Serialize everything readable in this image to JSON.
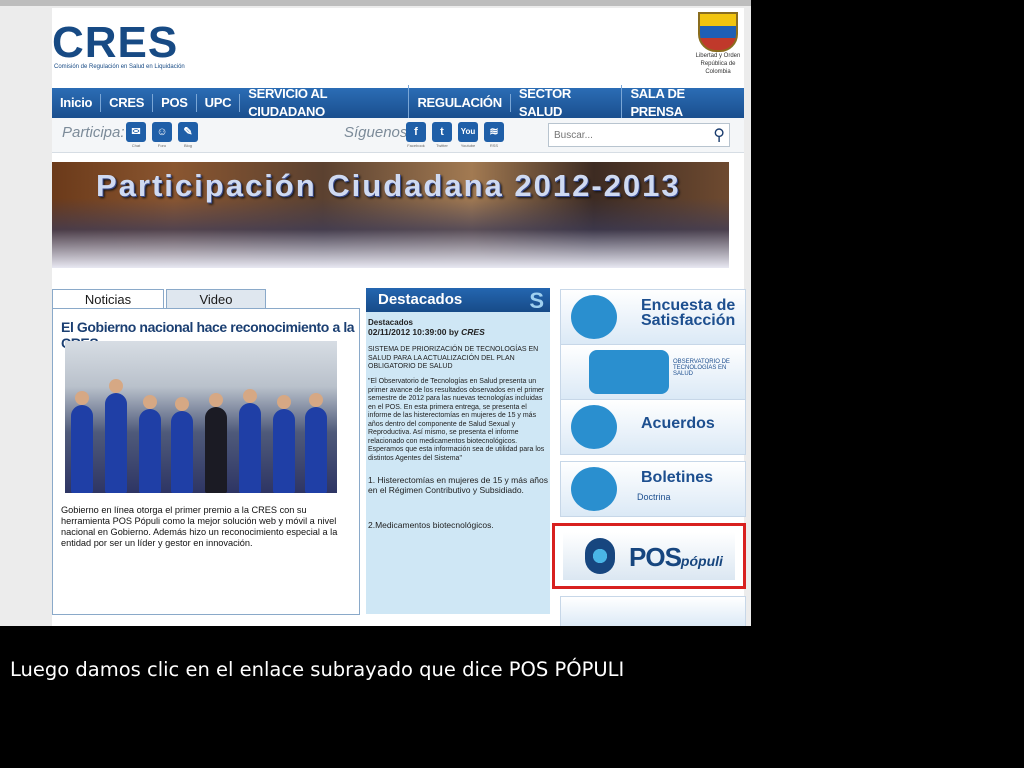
{
  "header": {
    "logo_text": "CRES",
    "logo_subtitle": "Comisión de Regulación en Salud en Liquidación",
    "seal_text_1": "Libertad y Orden",
    "seal_text_2": "República de Colombia"
  },
  "nav": {
    "items": [
      {
        "label": "Inicio"
      },
      {
        "label": "CRES"
      },
      {
        "label": "POS"
      },
      {
        "label": "UPC"
      },
      {
        "label": "SERVICIO AL CIUDADANO"
      },
      {
        "label": "REGULACIÓN"
      },
      {
        "label": "SECTOR SALUD"
      },
      {
        "label": "SALA DE PRENSA"
      }
    ]
  },
  "toolbar": {
    "participa_label": "Participa:",
    "participa_items": [
      {
        "caption": "Chat",
        "icon": "chat-icon"
      },
      {
        "caption": "Foro",
        "icon": "forum-icon"
      },
      {
        "caption": "Blog",
        "icon": "blog-icon"
      }
    ],
    "siguenos_label": "Síguenos:",
    "social_items": [
      {
        "caption": "Facebook",
        "icon": "facebook-icon",
        "glyph": "f"
      },
      {
        "caption": "Twitter",
        "icon": "twitter-icon",
        "glyph": "t"
      },
      {
        "caption": "Youtube",
        "icon": "youtube-icon",
        "glyph": "You"
      },
      {
        "caption": "RSS",
        "icon": "rss-icon",
        "glyph": "≋"
      }
    ],
    "search_placeholder": "Buscar..."
  },
  "banner": {
    "title": "Participación Ciudadana 2012-2013"
  },
  "news": {
    "tabs": [
      {
        "label": "Noticias"
      },
      {
        "label": "Video"
      }
    ],
    "headline": "El Gobierno nacional hace reconocimiento a la CRES",
    "body": "Gobierno en línea otorga el primer premio a la CRES con su herramienta POS Pópuli como la mejor solución web y móvil a nivel nacional en Gobierno. Además hizo un reconocimiento especial a la entidad por ser un líder y gestor en innovación."
  },
  "destacados": {
    "title": "Destacados",
    "meta_label": "Destacados",
    "meta_date": "02/11/2012 10:39:00 by",
    "meta_author": "CRES",
    "item1": "SISTEMA DE PRIORIZACIÓN DE TECNOLOGÍAS EN SALUD PARA LA ACTUALIZACIÓN DEL PLAN OBLIGATORIO DE SALUD",
    "item2": "\"El Observatorio de Tecnologías en Salud presenta un primer avance de los resultados observados en el primer semestre de 2012 para las nuevas tecnologías incluidas en el POS. En esta primera entrega, se presenta el informe de las histerectomías en mujeres de 15 y más años dentro del componente de Salud Sexual y Reproductiva. Así mismo, se presenta el informe relacionado con medicamentos biotecnológicos. Esperamos que esta información sea de utilidad para los distintos Agentes del Sistema\"",
    "list1": "1. Histerectomías en mujeres de 15 y más años en el Régimen Contributivo y Subsidiado.",
    "list2": "2.Medicamentos biotecnológicos."
  },
  "sidebar": {
    "encuesta_1": "Encuesta de",
    "encuesta_2": "Satisfacción",
    "observatorio": "OBSERVATORIO DE TECNOLOGÍAS EN SALUD",
    "acuerdos": "Acuerdos",
    "boletines_1": "Boletines",
    "boletines_2": "Doctrina",
    "pos_main": "POS",
    "pos_sub": "pópuli"
  },
  "caption": "Luego damos clic en el enlace subrayado que dice POS PÓPULI",
  "colors": {
    "nav_blue": "#1a4f8e",
    "highlight_red": "#d8201f",
    "destacados_bg": "#cfe7f5"
  }
}
